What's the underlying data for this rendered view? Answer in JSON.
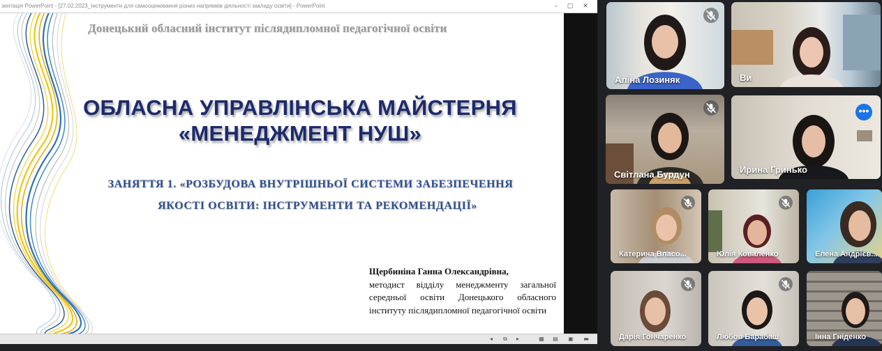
{
  "powerpoint": {
    "title_bar": "зентація PowerPoint - [27.02.2023_Інструменти для самооцінювання різних напрямків діяльності закладу освіти] - PowerPoint",
    "window_controls": {
      "minimize": "–",
      "restore": "▢",
      "close": "✕"
    },
    "slide": {
      "institute": "Донецький обласний інститут післядипломної педагогічної освіти",
      "title_line1": "ОБЛАСНА УПРАВЛІНСЬКА МАЙСТЕРНЯ",
      "title_line2": "«МЕНЕДЖМЕНТ НУШ»",
      "lesson_line1": "ЗАНЯТТЯ 1. «РОЗБУДОВА ВНУТРІШНЬОЇ СИСТЕМИ ЗАБЕЗПЕЧЕННЯ",
      "lesson_line2": "ЯКОСТІ ОСВІТИ: ІНСТРУМЕНТИ ТА РЕКОМЕНДАЦІЇ»",
      "author_name": "Щербиніна Ганна Олександрівна,",
      "author_role": "методист відділу менеджменту загальної середньої освіти Донецького обласного інституту післядипломної педагогічної освіти"
    },
    "status_icons": [
      "◂",
      "⧉",
      "▸",
      "▦",
      "▤",
      "▣",
      "▬"
    ]
  },
  "participants": [
    {
      "name": "Аліна Лозиняк",
      "muted": true
    },
    {
      "name": "Ви",
      "muted": false
    },
    {
      "name": "Світлана Бурдун",
      "muted": true
    },
    {
      "name": "Ирина Гринько",
      "muted": false,
      "pinned": true
    },
    {
      "name": "Катерина Власо...",
      "muted": true
    },
    {
      "name": "Юлія Коваленко",
      "muted": true
    },
    {
      "name": "Елена Андрієв...",
      "muted": false
    },
    {
      "name": "Дарія Гончаренко",
      "muted": true
    },
    {
      "name": "Любов Барабаш",
      "muted": true
    },
    {
      "name": "Інна Гнiденко",
      "muted": false
    }
  ],
  "more_options_icon": "•••",
  "colors": {
    "slide_title": "#1d2a6b",
    "slide_subtitle": "#2f4f8f",
    "accent_blue": "#8ab4f8",
    "more_button": "#1a73e8"
  }
}
